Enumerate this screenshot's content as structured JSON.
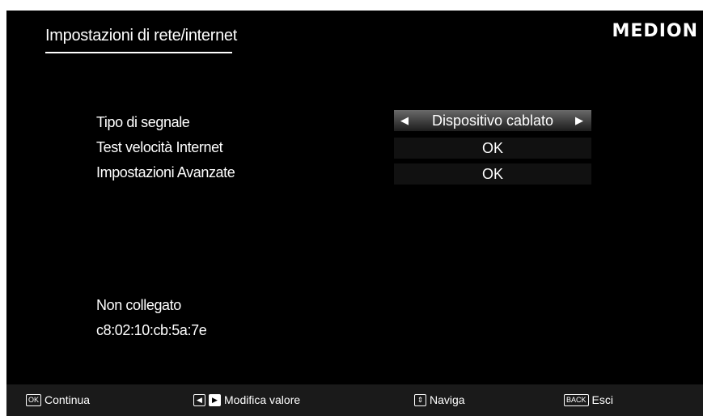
{
  "header": {
    "title": "Impostazioni di rete/internet",
    "logo": "MEDION"
  },
  "settings": [
    {
      "label": "Tipo di segnale",
      "value": "Dispositivo cablato"
    },
    {
      "label": "Test velocità Internet",
      "value": "OK"
    },
    {
      "label": "Impostazioni Avanzate",
      "value": "OK"
    }
  ],
  "status": {
    "connection": "Non collegato",
    "mac": "c8:02:10:cb:5a:7e"
  },
  "footer": {
    "ok_key": "OK",
    "ok_label": "Continua",
    "modify_label": "Modifica valore",
    "navigate_label": "Naviga",
    "back_key": "BACK",
    "back_label": "Esci"
  }
}
